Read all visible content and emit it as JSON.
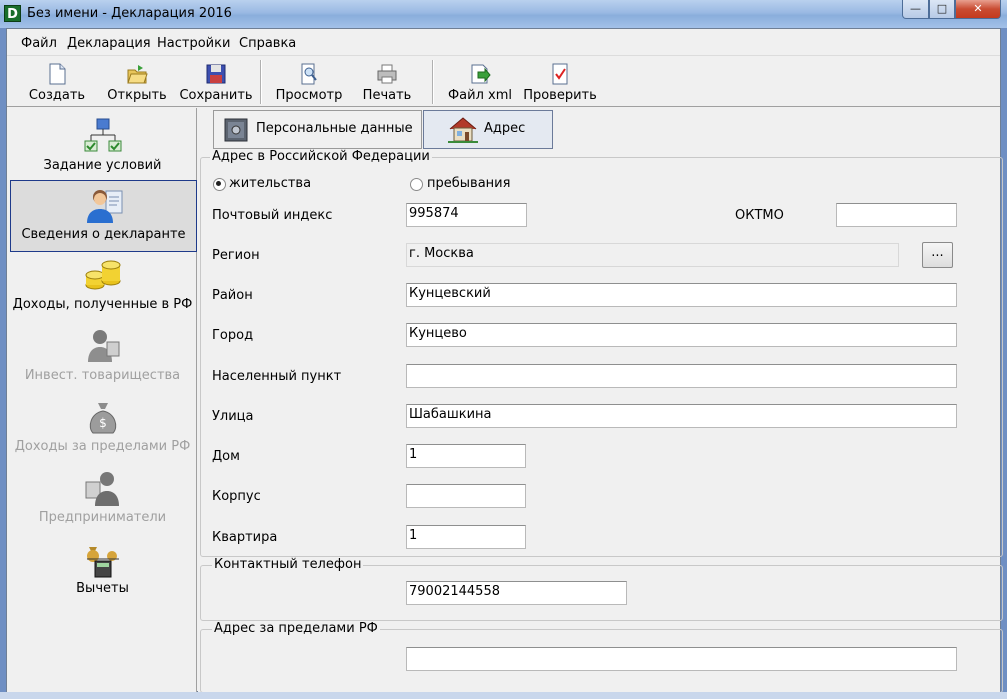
{
  "window": {
    "title": "Без имени - Декларация 2016",
    "app_icon_letter": "D"
  },
  "menu": [
    "Файл",
    "Декларация",
    "Настройки",
    "Справка"
  ],
  "toolbar": [
    "Создать",
    "Открыть",
    "Сохранить",
    "Просмотр",
    "Печать",
    "Файл xml",
    "Проверить"
  ],
  "nav": [
    {
      "label": "Задание условий",
      "icon": "conditions-tree-icon",
      "state": "normal"
    },
    {
      "label": "Сведения о декларанте",
      "icon": "person-icon",
      "state": "selected"
    },
    {
      "label": "Доходы, полученные в РФ",
      "icon": "coins-icon",
      "state": "normal"
    },
    {
      "label": "Инвест. товарищества",
      "icon": "handshake-icon",
      "state": "disabled"
    },
    {
      "label": "Доходы за пределами РФ",
      "icon": "money-bag-icon",
      "state": "disabled"
    },
    {
      "label": "Предприниматели",
      "icon": "businessman-icon",
      "state": "disabled"
    },
    {
      "label": "Вычеты",
      "icon": "calculator-icon",
      "state": "normal"
    }
  ],
  "tabs": [
    {
      "label": "Персональные данные",
      "active": false
    },
    {
      "label": "Адрес",
      "active": true
    }
  ],
  "address_rf": {
    "group_title": "Адрес в Российской Федерации",
    "radio_residence": "жительства",
    "radio_stay": "пребывания",
    "selected_radio": "жительства",
    "postal_code_label": "Почтовый индекс",
    "postal_code": "995874",
    "oktmo_label": "ОКТМО",
    "oktmo": "",
    "region_label": "Регион",
    "region": "г. Москва",
    "region_button": "...",
    "district_label": "Район",
    "district": "Кунцевский",
    "city_label": "Город",
    "city": "Кунцево",
    "settlement_label": "Населенный пункт",
    "settlement": "",
    "street_label": "Улица",
    "street": "Шабашкина",
    "house_label": "Дом",
    "house": "1",
    "building_label": "Корпус",
    "building": "",
    "apartment_label": "Квартира",
    "apartment": "1"
  },
  "phone": {
    "group_title": "Контактный телефон",
    "value": "79002144558"
  },
  "address_abroad": {
    "group_title": "Адрес за пределами РФ",
    "value": ""
  },
  "colors": {
    "title_bar": "#9ab9e3",
    "selection_border": "#1e3a8a",
    "close_button": "#c94c32"
  }
}
